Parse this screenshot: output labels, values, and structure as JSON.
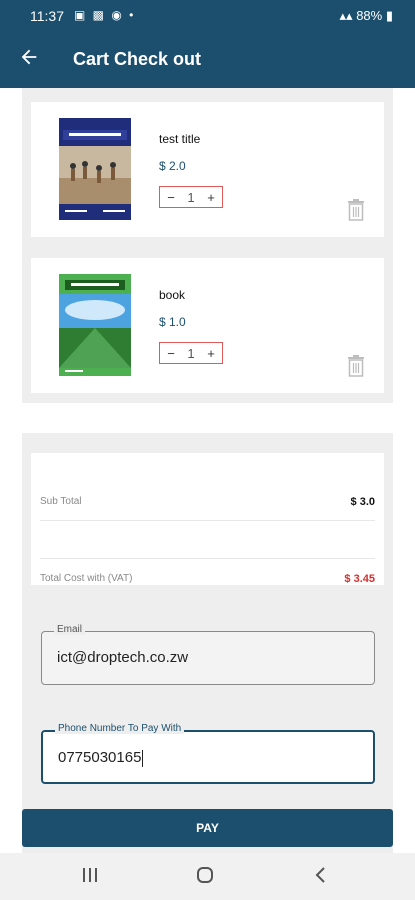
{
  "status_bar": {
    "time": "11:37",
    "battery": "88%"
  },
  "app_bar": {
    "title": "Cart Check out"
  },
  "cart": {
    "items": [
      {
        "title": "test title",
        "price": "$ 2.0",
        "quantity": "1",
        "cover_icon": "heritage-studies-book-cover"
      },
      {
        "title": "book",
        "price": "$ 1.0",
        "quantity": "1",
        "cover_icon": "agriculture-book-cover"
      }
    ]
  },
  "summary": {
    "subtotal_label": "Sub Total",
    "subtotal_value": "$ 3.0",
    "total_label": "Total Cost with (VAT)",
    "total_value": "$ 3.45"
  },
  "form": {
    "email_label": "Email",
    "email_value": "ict@droptech.co.zw",
    "phone_label": "Phone Number To Pay With",
    "phone_value": "0775030165"
  },
  "pay_label": "PAY",
  "colors": {
    "primary": "#1c4f6e",
    "accent_red": "#d32f2f"
  }
}
